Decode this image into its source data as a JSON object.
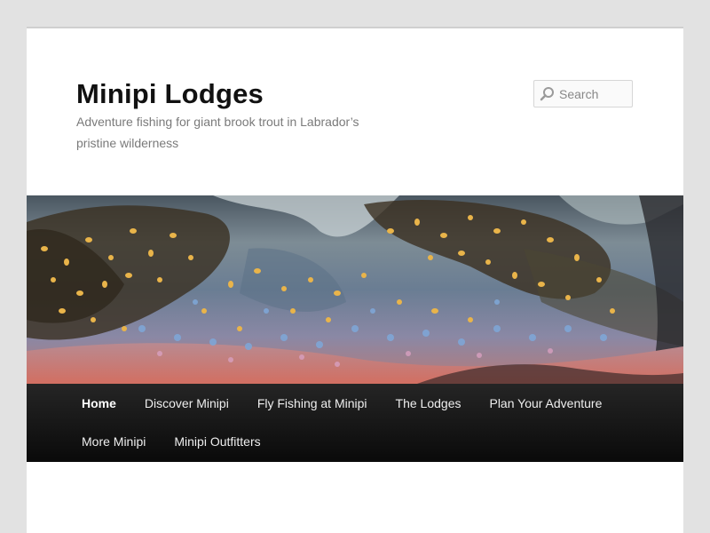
{
  "site": {
    "title": "Minipi Lodges",
    "description": "Adventure fishing for giant brook trout in Labrador’s pristine wilderness"
  },
  "search": {
    "placeholder": "Search",
    "value": ""
  },
  "nav": {
    "items": [
      {
        "label": "Home",
        "active": true
      },
      {
        "label": "Discover Minipi"
      },
      {
        "label": "Fly Fishing at Minipi"
      },
      {
        "label": "The Lodges"
      },
      {
        "label": "Plan Your Adventure"
      },
      {
        "label": "More Minipi"
      },
      {
        "label": "Minipi Outfitters"
      }
    ]
  },
  "colors": {
    "page_bg": "#e2e2e2",
    "nav_bg": "#1a1a1a",
    "title": "#111111",
    "description": "#7a7a7a"
  },
  "icons": {
    "search": "magnifier-icon"
  }
}
